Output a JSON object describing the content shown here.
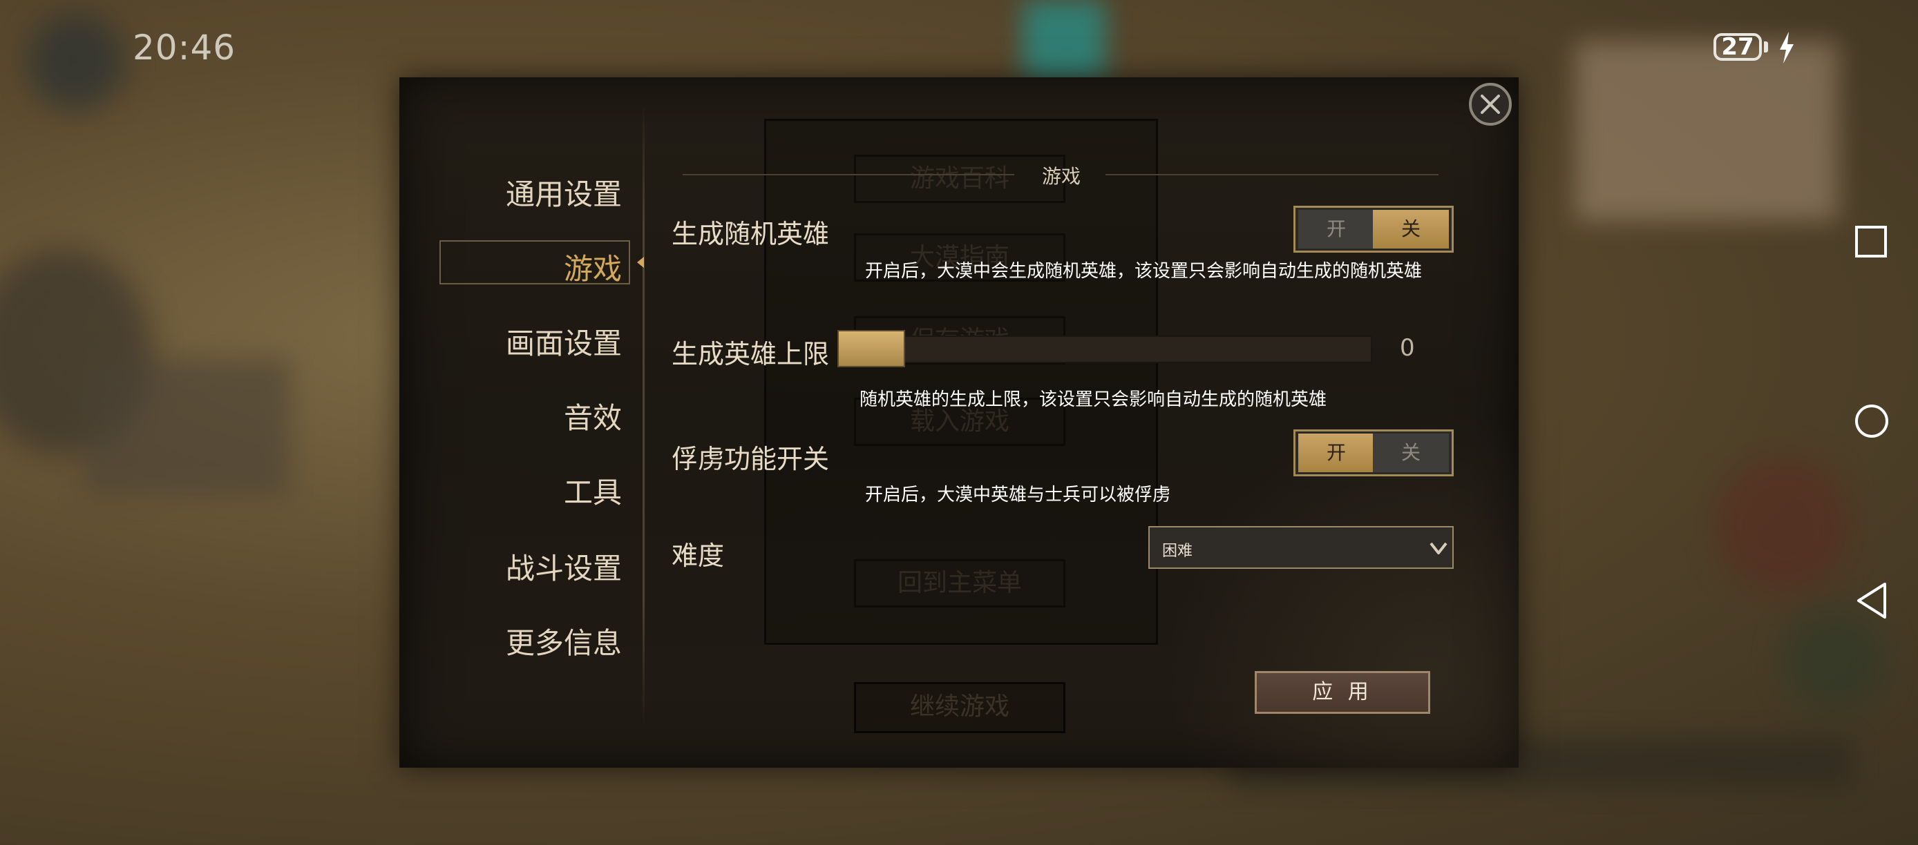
{
  "status_bar": {
    "time": "20:46",
    "battery_level": "27"
  },
  "dialog": {
    "sidebar": {
      "items": [
        {
          "label": "通用设置"
        },
        {
          "label": "游戏",
          "selected": true
        },
        {
          "label": "画面设置"
        },
        {
          "label": "音效"
        },
        {
          "label": "工具"
        },
        {
          "label": "战斗设置"
        },
        {
          "label": "更多信息"
        }
      ]
    },
    "section_title": "游戏",
    "settings": {
      "random_hero": {
        "label": "生成随机英雄",
        "on_label": "开",
        "off_label": "关",
        "value": "关",
        "description": "开启后，大漠中会生成随机英雄，该设置只会影响自动生成的随机英雄"
      },
      "hero_limit": {
        "label": "生成英雄上限",
        "value": "0",
        "description": "随机英雄的生成上限，该设置只会影响自动生成的随机英雄"
      },
      "capture": {
        "label": "俘虏功能开关",
        "on_label": "开",
        "off_label": "关",
        "value": "开",
        "description": "开启后，大漠中英雄与士兵可以被俘虏"
      },
      "difficulty": {
        "label": "难度",
        "selected": "困难"
      }
    },
    "apply_label": "应 用"
  },
  "background_menu": {
    "items": [
      "游戏百科",
      "大漠指南",
      "保存游戏",
      "载入游戏",
      "回到主菜单"
    ],
    "continue_label": "继续游戏"
  },
  "colors": {
    "accent_gold": "#c9a466",
    "dialog_bg": "#1f1a13"
  },
  "icons": [
    "close-icon",
    "charging-icon",
    "nav-recents-icon",
    "nav-home-icon",
    "nav-back-icon",
    "chevron-down-icon"
  ]
}
